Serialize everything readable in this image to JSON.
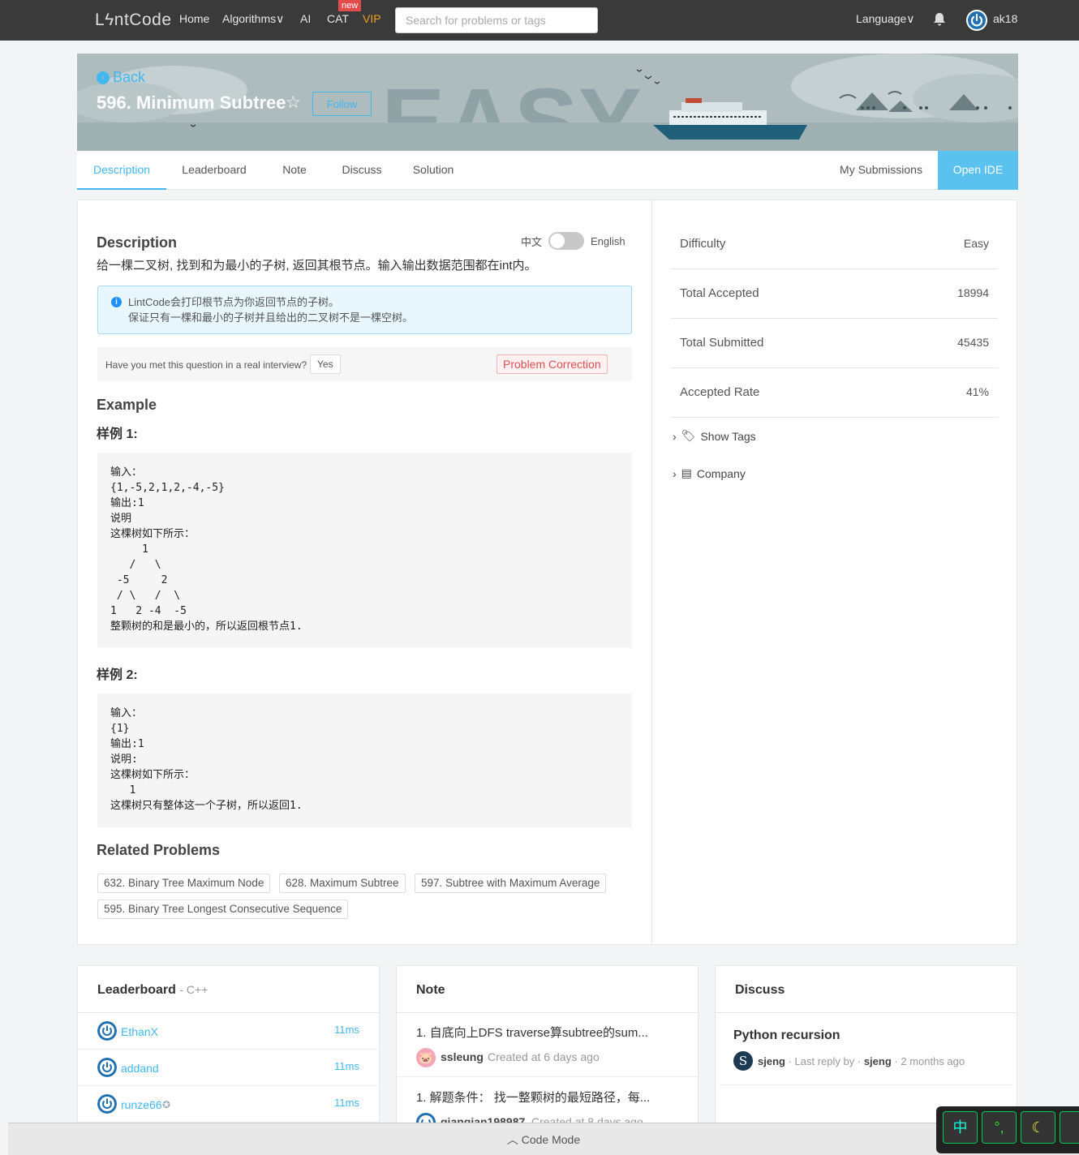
{
  "nav": {
    "logo": "LϟntCode",
    "home": "Home",
    "algorithms": "Algorithms∨",
    "ai": "AI",
    "cat": "CAT",
    "new_badge": "new",
    "vip": "VIP",
    "search_placeholder": "Search for problems or tags",
    "language": "Language∨",
    "username": "ak18"
  },
  "banner": {
    "back": "Back",
    "title": "596. Minimum Subtree",
    "follow": "Follow",
    "difficulty_watermark": "EASY"
  },
  "tabs": {
    "description": "Description",
    "leaderboard": "Leaderboard",
    "note": "Note",
    "discuss": "Discuss",
    "solution": "Solution",
    "my_submissions": "My Submissions",
    "open_ide": "Open IDE"
  },
  "description": {
    "heading": "Description",
    "lang_zh": "中文",
    "lang_en": "English",
    "text": "给一棵二叉树, 找到和为最小的子树, 返回其根节点。输入输出数据范围都在int内。",
    "info_line1": "LintCode会打印根节点为你返回节点的子树。",
    "info_line2": "保证只有一棵和最小的子树并且给出的二叉树不是一棵空树。",
    "interview_question": "Have you met this question in a real interview?",
    "yes": "Yes",
    "problem_correction": "Problem Correction"
  },
  "example": {
    "heading": "Example",
    "label1": "样例 1:",
    "code1": "输入：\n{1,-5,2,1,2,-4,-5}\n输出:1\n说明\n这棵树如下所示：\n     1\n   /   \\\n -5     2\n / \\   /  \\\n1   2 -4  -5 \n整颗树的和是最小的，所以返回根节点1.",
    "label2": "样例 2:",
    "code2": "输入：\n{1}\n输出:1\n说明:\n这棵树如下所示：\n   1\n这棵树只有整体这一个子树，所以返回1."
  },
  "related": {
    "heading": "Related Problems",
    "items": [
      "632. Binary Tree Maximum Node",
      "628. Maximum Subtree",
      "597. Subtree with Maximum Average",
      "595. Binary Tree Longest Consecutive Sequence"
    ]
  },
  "stats": {
    "difficulty_label": "Difficulty",
    "difficulty": "Easy",
    "accepted_label": "Total Accepted",
    "accepted": "18994",
    "submitted_label": "Total Submitted",
    "submitted": "45435",
    "rate_label": "Accepted Rate",
    "rate": "41%",
    "show_tags": "Show Tags",
    "company": "Company"
  },
  "leaderboard": {
    "heading": "Leaderboard",
    "lang": "- C++",
    "rows": [
      {
        "name": "EthanX",
        "time": "11ms"
      },
      {
        "name": "addand",
        "time": "11ms"
      },
      {
        "name": "runze66",
        "time": "11ms"
      }
    ]
  },
  "notes": {
    "heading": "Note",
    "items": [
      {
        "title": "1. 自底向上DFS traverse算subtree的sum...",
        "author": "ssleung",
        "created": "Created at 6 days ago"
      },
      {
        "title": "1. 解题条件： 找一整颗树的最短路径，每...",
        "author": "qianqian198987",
        "created": "Created at 8 days ago"
      }
    ]
  },
  "discuss": {
    "heading": "Discuss",
    "title": "Python recursion",
    "author": "sjeng",
    "last_reply": "· Last reply by ·",
    "reply_author": "sjeng",
    "ago": "· 2 months ago",
    "avatar_letter": "S"
  },
  "footer": {
    "code_mode": "Code Mode"
  },
  "ime": {
    "zh": "中",
    "punct": "°,",
    "moon": "☾"
  },
  "colors": {
    "accent": "#41b7ef",
    "nav_bg": "#3a3a3a",
    "vip": "#f0a020",
    "correction": "#e05050"
  }
}
